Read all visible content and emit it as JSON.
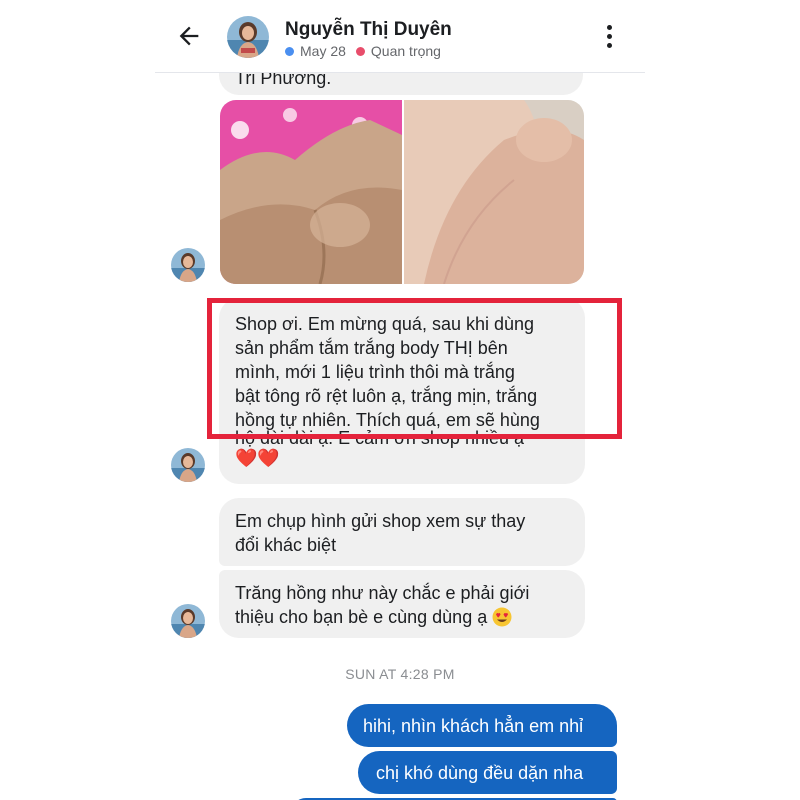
{
  "header": {
    "name": "Nguyễn Thị Duyên",
    "date": "May 28",
    "label": "Quan trọng"
  },
  "messages": {
    "partial_text": "Tri Phương.",
    "testimonial_lines": [
      "Shop ơi. Em mừng quá, sau khi dùng",
      "sản phẩm tắm trắng body THỊ bên",
      "mình,  mới 1 liệu trình thôi mà trắng",
      "bật tông rõ rệt luôn ạ, trắng mịn, trắng",
      "hồng tự nhiên. Thích quá, em sẽ hùng",
      "hộ dài dài ạ. E cảm ơn shop nhiều ạ"
    ],
    "hearts": "❤️❤️",
    "msg2_lines": [
      "Em chụp hình gửi shop xem sự thay",
      "đổi khác biệt"
    ],
    "msg3_lines": [
      "Trăng hồng như này chắc e phải giới",
      "thiệu cho bạn bè e cùng dùng ạ"
    ],
    "timestamp": "SUN AT 4:28 PM",
    "sent1": "hihi, nhìn khách hẳn em nhỉ",
    "sent2": "chị khó dùng đều dặn nha"
  },
  "colors": {
    "sent_bubble": "#1565c0",
    "received_bubble": "#f0f0f0",
    "highlight": "#e4233b"
  },
  "icons": [
    "back-arrow-icon",
    "more-vertical-icon",
    "heart-emoji",
    "heart-eyes-emoji"
  ]
}
